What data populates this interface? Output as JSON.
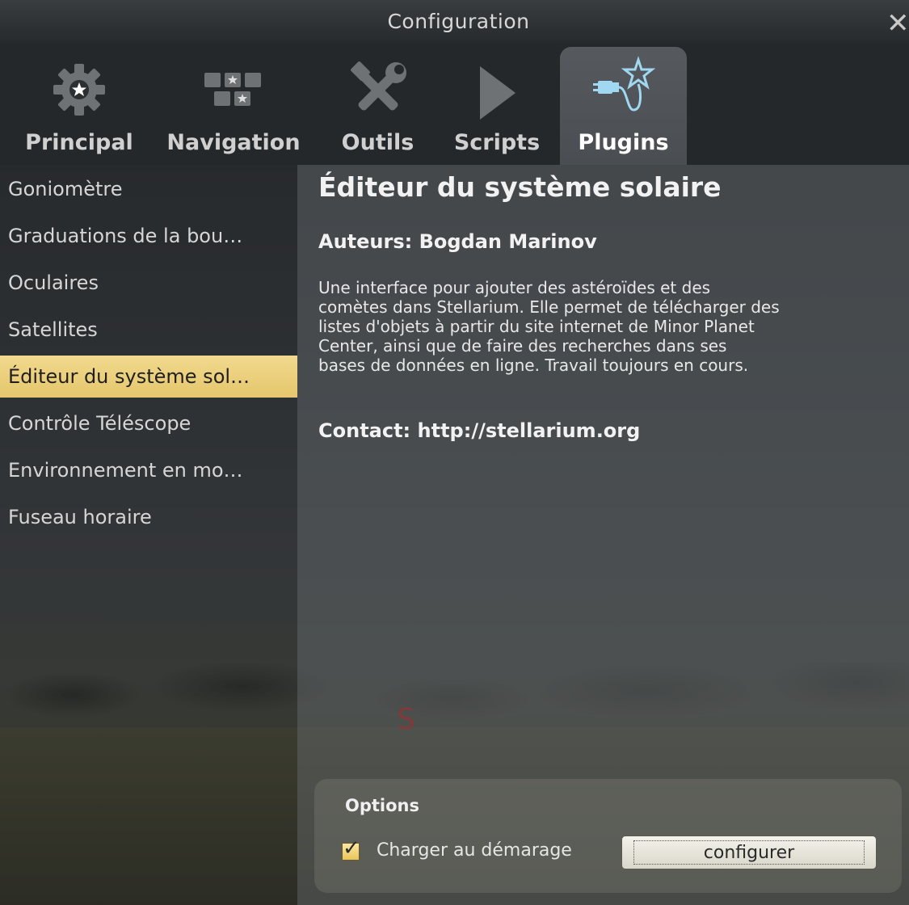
{
  "window": {
    "title": "Configuration",
    "close_icon": "close-icon"
  },
  "tabs": [
    {
      "label": "Principal",
      "icon": "gear-star-icon",
      "active": false
    },
    {
      "label": "Navigation",
      "icon": "navigation-grid-icon",
      "active": false
    },
    {
      "label": "Outils",
      "icon": "tools-icon",
      "active": false
    },
    {
      "label": "Scripts",
      "icon": "play-icon",
      "active": false
    },
    {
      "label": "Plugins",
      "icon": "plug-star-icon",
      "active": true
    }
  ],
  "plugins_list": [
    {
      "label": "Goniomètre",
      "selected": false
    },
    {
      "label": "Graduations de la bou…",
      "selected": false
    },
    {
      "label": "Oculaires",
      "selected": false
    },
    {
      "label": "Satellites",
      "selected": false
    },
    {
      "label": "Éditeur du système sol…",
      "selected": true
    },
    {
      "label": "Contrôle Téléscope",
      "selected": false
    },
    {
      "label": "Environnement en mo…",
      "selected": false
    },
    {
      "label": "Fuseau horaire",
      "selected": false
    }
  ],
  "plugin_detail": {
    "title": "Éditeur du système solaire",
    "authors": "Auteurs: Bogdan Marinov",
    "description_lines": [
      "Une interface pour ajouter des astéroïdes et des",
      "comètes dans Stellarium. Elle permet de télécharger des",
      "listes d'objets à partir du site internet de Minor Planet",
      "Center, ainsi que de faire des recherches dans ses",
      "bases de données en ligne. Travail toujours en cours."
    ],
    "contact": "Contact: http://stellarium.org"
  },
  "options": {
    "title": "Options",
    "load_at_startup_label": "Charger au démarage",
    "load_at_startup_checked": true,
    "configure_button": "configurer"
  },
  "background": {
    "compass_label": "S"
  },
  "colors": {
    "selected_item": "#e9cc77",
    "active_tab": "#54585c",
    "title_bar": "#2b2e31"
  }
}
